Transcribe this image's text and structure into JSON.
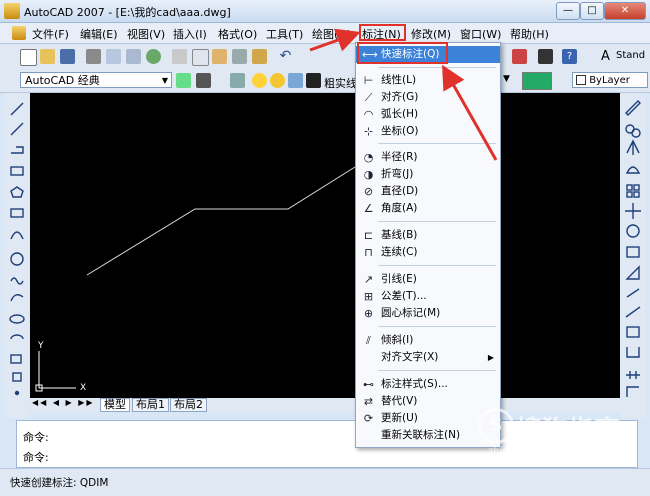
{
  "window": {
    "title": "AutoCAD 2007 - [E:\\我的cad\\aaa.dwg]",
    "minimize": "—",
    "maximize": "□",
    "close": "✕"
  },
  "menubar": {
    "items": [
      "文件(F)",
      "编辑(E)",
      "视图(V)",
      "插入(I)",
      "格式(O)",
      "工具(T)",
      "绘图(D)",
      "标注(N)",
      "修改(M)",
      "窗口(W)",
      "帮助(H)"
    ]
  },
  "toolbar": {
    "workspace": "AutoCAD 经典",
    "layer_label": "粗实线",
    "bylayer": "ByLayer",
    "text_style": "Stand"
  },
  "dimension_menu": {
    "items": [
      {
        "label": "快速标注(Q)",
        "icon": "quick-dimension-icon"
      },
      {
        "label": "线性(L)",
        "icon": "linear-icon"
      },
      {
        "label": "对齐(G)",
        "icon": "aligned-icon"
      },
      {
        "label": "弧长(H)",
        "icon": "arc-length-icon"
      },
      {
        "label": "坐标(O)",
        "icon": "ordinate-icon"
      },
      {
        "label": "半径(R)",
        "icon": "radius-icon"
      },
      {
        "label": "折弯(J)",
        "icon": "jogged-icon"
      },
      {
        "label": "直径(D)",
        "icon": "diameter-icon"
      },
      {
        "label": "角度(A)",
        "icon": "angular-icon"
      },
      {
        "label": "基线(B)",
        "icon": "baseline-icon"
      },
      {
        "label": "连续(C)",
        "icon": "continue-icon"
      },
      {
        "label": "引线(E)",
        "icon": "leader-icon"
      },
      {
        "label": "公差(T)...",
        "icon": "tolerance-icon"
      },
      {
        "label": "圆心标记(M)",
        "icon": "center-mark-icon"
      },
      {
        "label": "倾斜(I)",
        "icon": "oblique-icon"
      },
      {
        "label": "对齐文字(X)",
        "icon": ""
      },
      {
        "label": "标注样式(S)...",
        "icon": "dimension-style-icon"
      },
      {
        "label": "替代(V)",
        "icon": "override-icon"
      },
      {
        "label": "更新(U)",
        "icon": "update-icon"
      },
      {
        "label": "重新关联标注(N)",
        "icon": ""
      }
    ]
  },
  "layout_tabs": [
    "模型",
    "布局1",
    "布局2"
  ],
  "command": {
    "line1": "命令:",
    "line2": "命令:"
  },
  "status": {
    "text": "快速创建标注:  QDIM"
  },
  "axis": {
    "x": "X",
    "y": "Y"
  },
  "watermark": "搜狗指南",
  "watermark_url": "zhinan.sogou.com",
  "colors": {
    "highlight": "#3b82d8",
    "annotation": "#e0312a",
    "canvas": "#000000"
  }
}
